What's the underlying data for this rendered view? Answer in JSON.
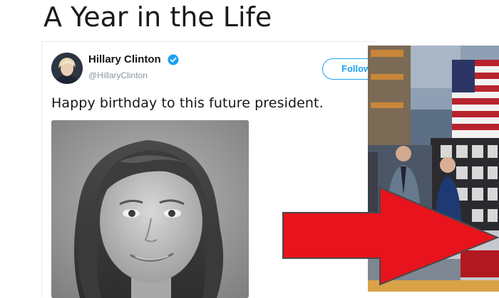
{
  "page": {
    "title": "A Year in the Life"
  },
  "tweet": {
    "display_name": "Hillary Clinton",
    "handle": "@HillaryClinton",
    "follow_label": "Follow",
    "text": "Happy birthday to this future president."
  },
  "colors": {
    "twitter_blue": "#1da1f2",
    "verified_badge": "#1da1f2",
    "arrow_red": "#e8131c",
    "arrow_outline": "#4a4a4a"
  },
  "icons": {
    "verified": "verified-check-icon",
    "arrow": "red-arrow-icon"
  }
}
